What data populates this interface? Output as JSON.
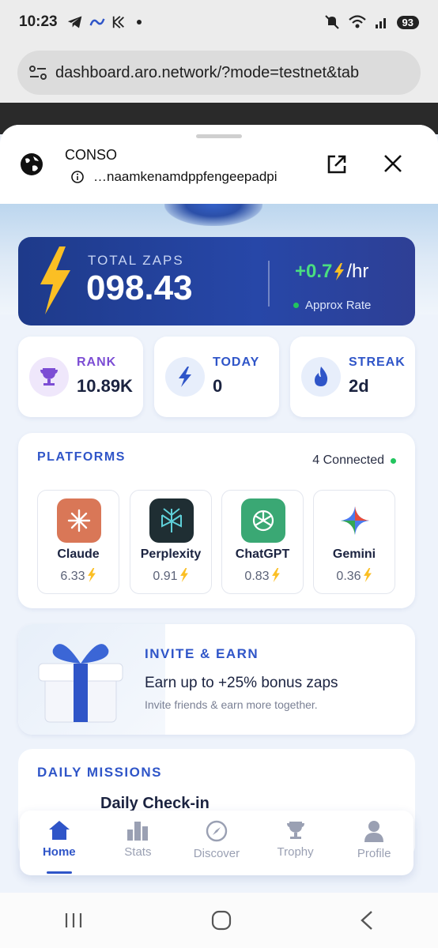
{
  "status_bar": {
    "time": "10:23",
    "battery": "93",
    "left_icons": [
      "telegram-icon",
      "meta-icon",
      "kraken-icon",
      "dot"
    ],
    "right_icons": [
      "mute-icon",
      "wifi-icon",
      "signal-icon"
    ]
  },
  "browser": {
    "url": "dashboard.aro.network/?mode=testnet&tab"
  },
  "sheet": {
    "title": "CONSO",
    "subtitle": "…naamkenamdppfengeepadpi"
  },
  "total_zaps": {
    "label": "TOTAL ZAPS",
    "value": "098.43",
    "rate": "+0.7",
    "rate_unit": "/hr",
    "rate_label": "Approx Rate"
  },
  "stats": [
    {
      "label": "RANK",
      "value": "10.89K",
      "color": "#7c4dd4"
    },
    {
      "label": "TODAY",
      "value": "0",
      "color": "#2f55c8"
    },
    {
      "label": "STREAK",
      "value": "2d",
      "color": "#2f55c8"
    }
  ],
  "platforms": {
    "title": "PLATFORMS",
    "connected": "4 Connected",
    "items": [
      {
        "name": "Claude",
        "value": "6.33"
      },
      {
        "name": "Perplexity",
        "value": "0.91"
      },
      {
        "name": "ChatGPT",
        "value": "0.83"
      },
      {
        "name": "Gemini",
        "value": "0.36"
      }
    ]
  },
  "invite": {
    "title": "INVITE & EARN",
    "headline": "Earn up to +25% bonus zaps",
    "sub": "Invite friends & earn more together."
  },
  "missions": {
    "title": "DAILY MISSIONS",
    "first": "Daily Check-in"
  },
  "nav": [
    "Home",
    "Stats",
    "Discover",
    "Trophy",
    "Profile"
  ],
  "colors": {
    "accent": "#2f55c8",
    "card_dark": "#1e3a8a",
    "green": "#22c55e",
    "bolt": "#fbbf24"
  }
}
